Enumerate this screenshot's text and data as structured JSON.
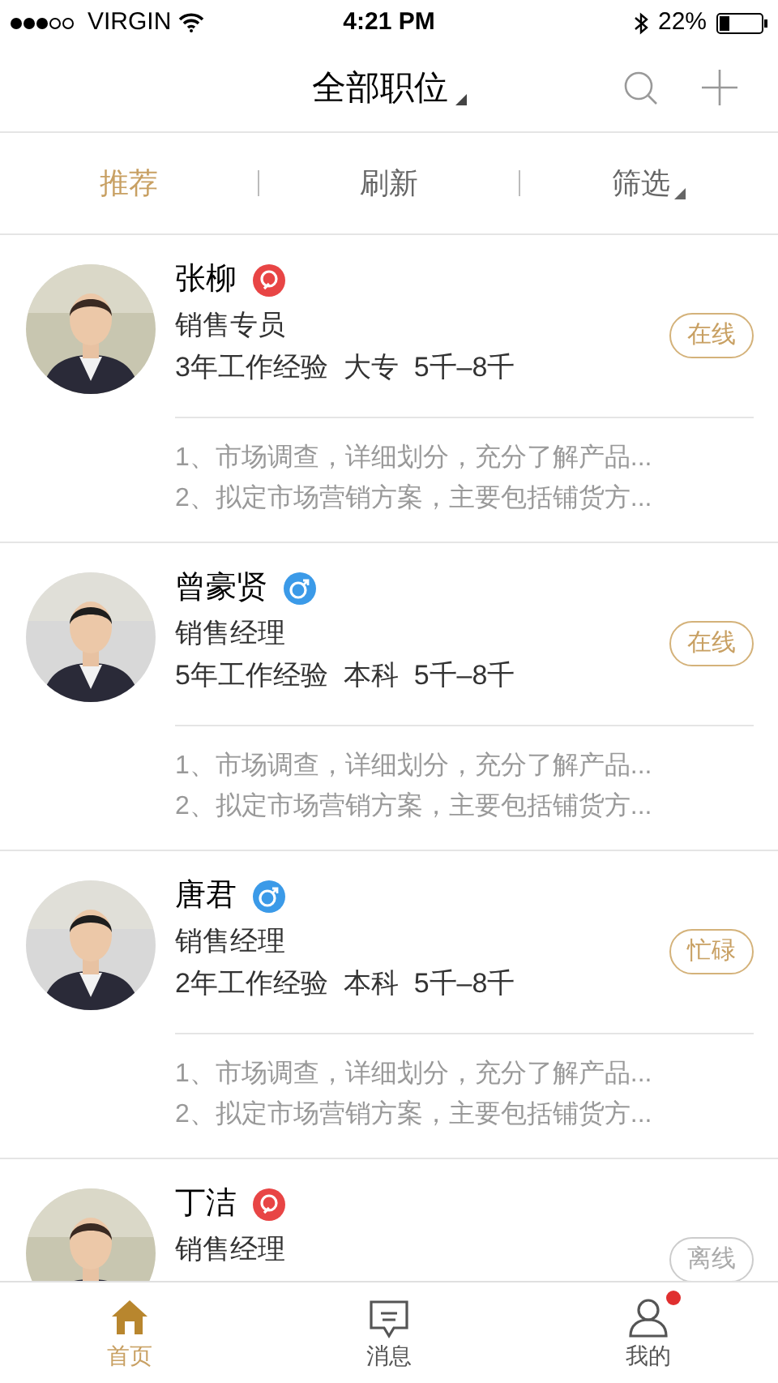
{
  "status_bar": {
    "carrier": "VIRGIN",
    "time": "4:21 PM",
    "battery": "22%"
  },
  "header": {
    "title": "全部职位"
  },
  "tabs": [
    {
      "label": "推荐",
      "selected": true,
      "dropdown": false
    },
    {
      "label": "刷新",
      "selected": false,
      "dropdown": false
    },
    {
      "label": "筛选",
      "selected": false,
      "dropdown": true
    }
  ],
  "candidates": [
    {
      "name": "张柳",
      "kind": "female",
      "title": "销售专员",
      "info": "3年工作经验  大专  5千–8千",
      "status": "在线",
      "offline": false,
      "description": [
        "1、市场调查，详细划分，充分了解产品...",
        "2、拟定市场营销方案，主要包括铺货方..."
      ]
    },
    {
      "name": "曾豪贤",
      "kind": "male",
      "title": "销售经理",
      "info": "5年工作经验  本科  5千–8千",
      "status": "在线",
      "offline": false,
      "description": [
        "1、市场调查，详细划分，充分了解产品...",
        "2、拟定市场营销方案，主要包括铺货方..."
      ]
    },
    {
      "name": "唐君",
      "kind": "male",
      "title": "销售经理",
      "info": "2年工作经验  本科  5千–8千",
      "status": "忙碌",
      "offline": false,
      "description": [
        "1、市场调查，详细划分，充分了解产品...",
        "2、拟定市场营销方案，主要包括铺货方..."
      ]
    },
    {
      "name": "丁洁",
      "kind": "female",
      "title": "销售经理",
      "status": "离线",
      "offline": true
    }
  ],
  "bottom_nav": [
    {
      "label": "首页",
      "kind": "home",
      "selected": true,
      "badge": false
    },
    {
      "label": "消息",
      "kind": "message",
      "selected": false,
      "badge": false
    },
    {
      "label": "我的",
      "kind": "profile",
      "selected": false,
      "badge": true
    }
  ]
}
